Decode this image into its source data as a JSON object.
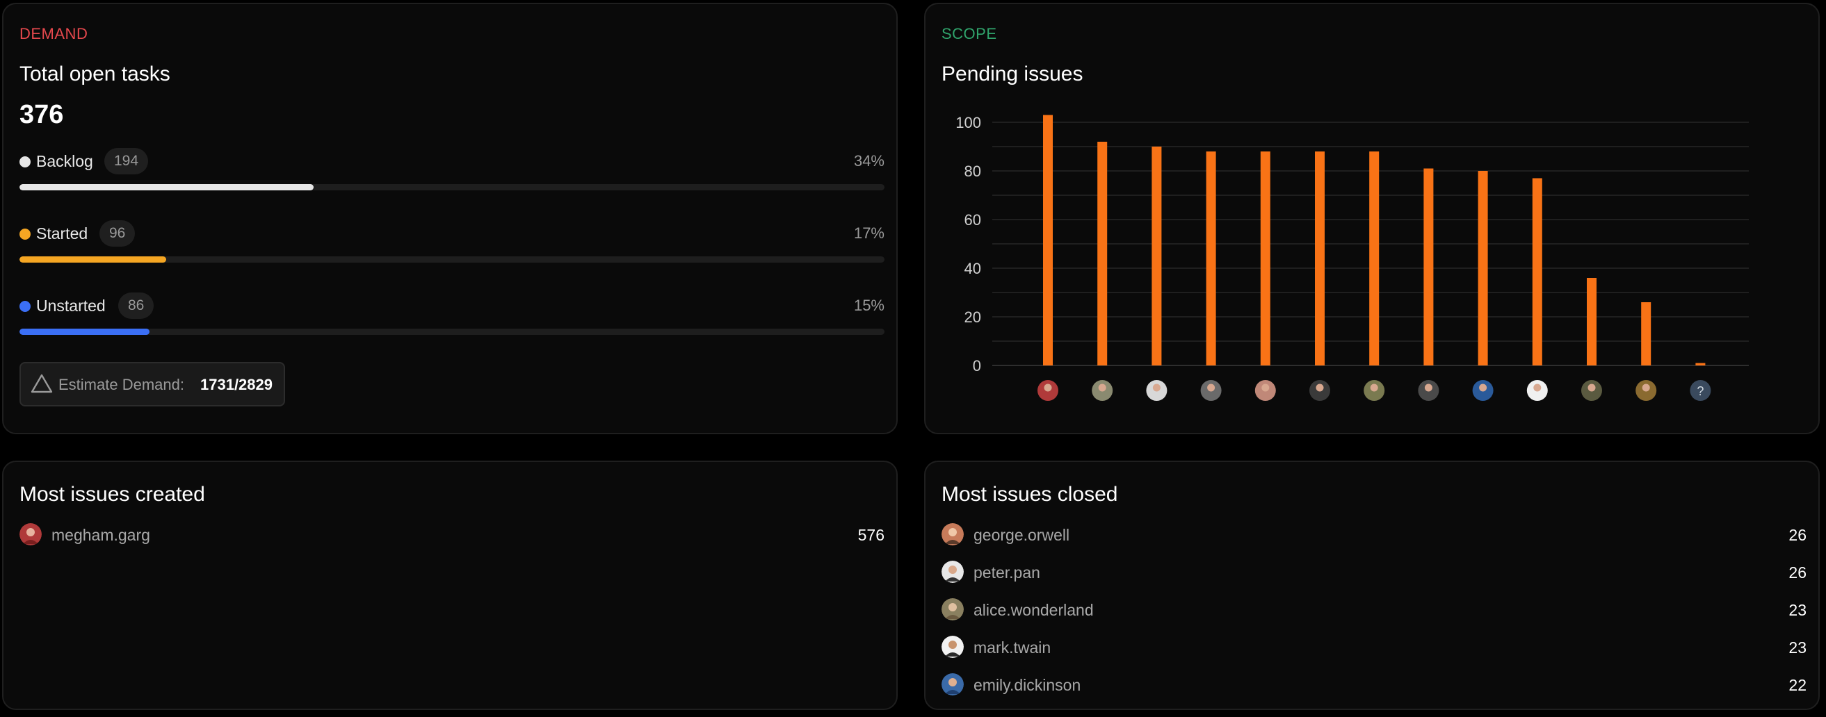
{
  "demand": {
    "eyebrow": "DEMAND",
    "eyebrow_color": "#e5484d",
    "title": "Total open tasks",
    "total": "376",
    "statuses": [
      {
        "label": "Backlog",
        "count": "194",
        "percent_text": "34%",
        "fill_fraction": 0.34,
        "color": "#e6e6e6"
      },
      {
        "label": "Started",
        "count": "96",
        "percent_text": "17%",
        "fill_fraction": 0.17,
        "color": "#f5a623"
      },
      {
        "label": "Unstarted",
        "count": "86",
        "percent_text": "15%",
        "fill_fraction": 0.15,
        "color": "#3b6ff5"
      }
    ],
    "estimate": {
      "icon": "triangle-icon",
      "label": "Estimate Demand:",
      "value": "1731/2829"
    }
  },
  "scope": {
    "eyebrow": "SCOPE",
    "eyebrow_color": "#30a46c",
    "title": "Pending issues"
  },
  "chart_data": {
    "type": "bar",
    "title": "Pending issues",
    "xlabel": "",
    "ylabel": "",
    "categories": [
      "avatar-1",
      "avatar-2",
      "avatar-3",
      "avatar-4",
      "avatar-5",
      "avatar-6",
      "avatar-7",
      "avatar-8",
      "avatar-9",
      "avatar-10",
      "avatar-11",
      "avatar-12",
      "unknown-user"
    ],
    "values": [
      103,
      92,
      90,
      88,
      88,
      88,
      88,
      81,
      80,
      77,
      36,
      26,
      1
    ],
    "yticks": [
      "0",
      "20",
      "40",
      "60",
      "80",
      "100"
    ],
    "ylim": [
      0,
      100
    ],
    "grid": true,
    "bar_color": "#f97316",
    "unknown_label": "?"
  },
  "created": {
    "title": "Most issues created",
    "users": [
      {
        "name": "megham.garg",
        "value": "576"
      }
    ]
  },
  "closed": {
    "title": "Most issues closed",
    "users": [
      {
        "name": "george.orwell",
        "value": "26"
      },
      {
        "name": "peter.pan",
        "value": "26"
      },
      {
        "name": "alice.wonderland",
        "value": "23"
      },
      {
        "name": "mark.twain",
        "value": "23"
      },
      {
        "name": "emily.dickinson",
        "value": "22"
      }
    ]
  }
}
